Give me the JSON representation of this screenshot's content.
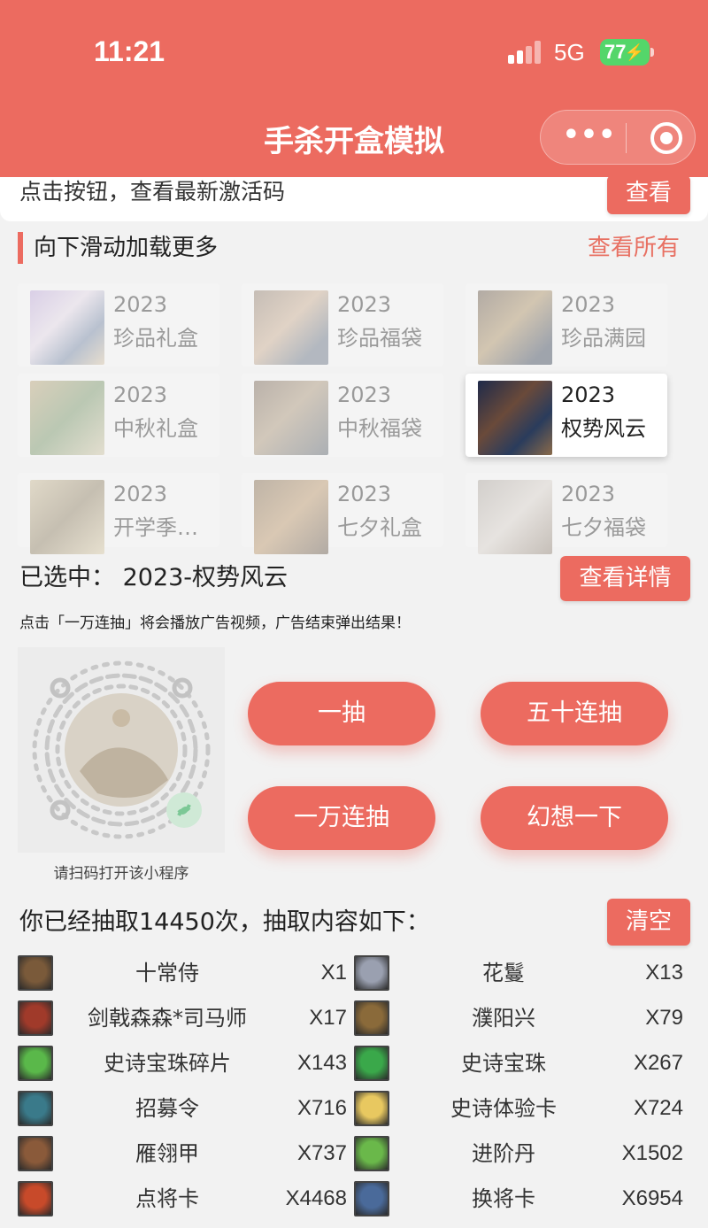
{
  "status": {
    "time": "11:21",
    "network": "5G",
    "battery": "77"
  },
  "app": {
    "title": "手杀开盒模拟"
  },
  "activation": {
    "text": "点击按钮，查看最新激活码",
    "button": "查看"
  },
  "section": {
    "title": "向下滑动加载更多",
    "view_all": "查看所有"
  },
  "boxes": [
    {
      "year": "2023",
      "name": "珍品礼盒"
    },
    {
      "year": "2023",
      "name": "珍品福袋"
    },
    {
      "year": "2023",
      "name": "珍品满园"
    },
    {
      "year": "2023",
      "name": "中秋礼盒"
    },
    {
      "year": "2023",
      "name": "中秋福袋"
    },
    {
      "year": "2023",
      "name": "权势风云"
    },
    {
      "year": "2023",
      "name": "开学季福..."
    },
    {
      "year": "2023",
      "name": "七夕礼盒"
    },
    {
      "year": "2023",
      "name": "七夕福袋"
    }
  ],
  "selected": {
    "label": "已选中：  2023-权势风云",
    "detail_button": "查看详情"
  },
  "ad_note": "点击「一万连抽」将会播放广告视频，广告结束弹出结果！",
  "qr": {
    "caption": "请扫码打开该小程序"
  },
  "draw_buttons": {
    "one": "一抽",
    "fifty": "五十连抽",
    "ten_thousand": "一万连抽",
    "imagine": "幻想一下"
  },
  "results": {
    "title": "你已经抽取14450次，抽取内容如下：",
    "clear_button": "清空",
    "items": [
      {
        "name": "十常侍",
        "count": "X1",
        "color": "#7a5a3a"
      },
      {
        "name": "花鬘",
        "count": "X13",
        "color": "#9aa0b0"
      },
      {
        "name": "剑戟森森*司马师",
        "count": "X17",
        "color": "#a03a2a"
      },
      {
        "name": "濮阳兴",
        "count": "X79",
        "color": "#8a6a3a"
      },
      {
        "name": "史诗宝珠碎片",
        "count": "X143",
        "color": "#5ab84a"
      },
      {
        "name": "史诗宝珠",
        "count": "X267",
        "color": "#3aa84a"
      },
      {
        "name": "招募令",
        "count": "X716",
        "color": "#3a7a8a"
      },
      {
        "name": "史诗体验卡",
        "count": "X724",
        "color": "#e8c860"
      },
      {
        "name": "雁翎甲",
        "count": "X737",
        "color": "#8a5a3a"
      },
      {
        "name": "进阶丹",
        "count": "X1502",
        "color": "#6ab84a"
      },
      {
        "name": "点将卡",
        "count": "X4468",
        "color": "#c84a2a"
      },
      {
        "name": "换将卡",
        "count": "X6954",
        "color": "#4a6a9a"
      }
    ]
  }
}
